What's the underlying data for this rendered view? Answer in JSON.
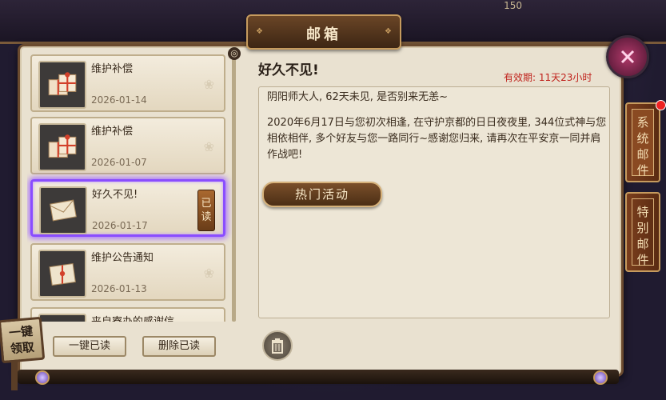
{
  "header": {
    "title": "邮箱",
    "top_number": "150"
  },
  "mail_list": [
    {
      "title": "维护补偿",
      "date": "2026-01-14",
      "icon": "gift-box-icon",
      "read": false,
      "selected": false
    },
    {
      "title": "维护补偿",
      "date": "2026-01-07",
      "icon": "gift-box-icon",
      "read": false,
      "selected": false
    },
    {
      "title": "好久不见!",
      "date": "2026-01-17",
      "icon": "letter-icon",
      "read": true,
      "read_label": "已读",
      "selected": true
    },
    {
      "title": "维护公告通知",
      "date": "2026-01-13",
      "icon": "sealed-letter-icon",
      "read": false,
      "selected": false
    },
    {
      "title": "来自寮办的感谢信",
      "date": "",
      "icon": "letter-icon",
      "read": false,
      "selected": false
    }
  ],
  "list_buttons": {
    "read_all": "一键已读",
    "delete_read": "删除已读"
  },
  "claim_all": {
    "line1": "一键",
    "line2": "领取"
  },
  "detail": {
    "title": "好久不见!",
    "expiry": "有效期: 11天23小时",
    "paragraphs": [
      "阴阳师大人, 62天未见, 是否别来无恙~",
      "2020年6月17日与您初次相逢, 在守护京都的日日夜夜里, 344位式神与您相依相伴, 多个好友与您一路同行~感谢您归来, 请再次在平安京一同并肩作战吧!"
    ],
    "action_button": "热门活动"
  },
  "side_tabs": [
    {
      "label": "系统邮件",
      "active": true,
      "has_notice": true
    },
    {
      "label": "特别邮件",
      "active": false,
      "has_notice": false
    }
  ],
  "colors": {
    "selected_glow": "#8a4dff",
    "expiry_red": "#c0221c",
    "parchment": "#e9e1d0"
  }
}
